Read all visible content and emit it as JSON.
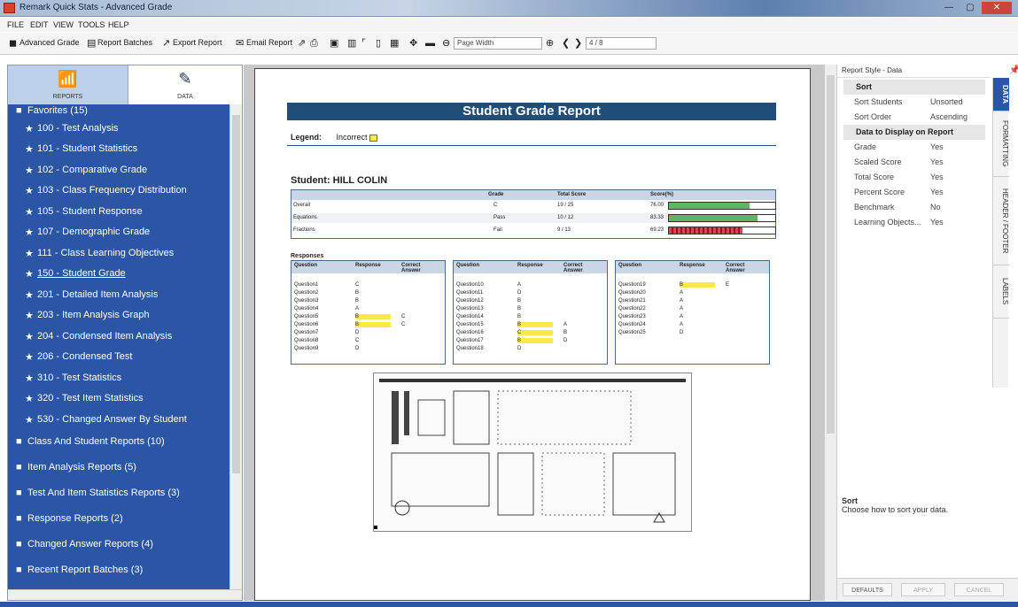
{
  "window": {
    "title": "Remark Quick Stats - Advanced Grade",
    "controls": [
      "—",
      "▢",
      "✕"
    ]
  },
  "menu": [
    "FILE",
    "EDIT",
    "VIEW",
    "TOOLS",
    "HELP"
  ],
  "toolbar": {
    "advanced_grade": "Advanced Grade",
    "report_batches": "Report Batches",
    "export_report": "Export Report",
    "email_report": "Email Report",
    "zoom": "Page Width",
    "page": "4 / 8"
  },
  "sidebar": {
    "tabs": [
      {
        "label": "REPORTS",
        "icon": "bar-chart-icon"
      },
      {
        "label": "DATA",
        "icon": "edit-icon"
      }
    ],
    "items": [
      {
        "label": "Favorites (15)",
        "type": "folder"
      },
      {
        "label": "100 - Test Analysis",
        "type": "star"
      },
      {
        "label": "101 - Student Statistics",
        "type": "star"
      },
      {
        "label": "102 - Comparative Grade",
        "type": "star"
      },
      {
        "label": "103 - Class Frequency Distribution",
        "type": "star"
      },
      {
        "label": "105 - Student Response",
        "type": "star"
      },
      {
        "label": "107 - Demographic Grade",
        "type": "star"
      },
      {
        "label": "111 - Class Learning Objectives",
        "type": "star"
      },
      {
        "label": "150 - Student Grade",
        "type": "star"
      },
      {
        "label": "201 - Detailed Item Analysis",
        "type": "star"
      },
      {
        "label": "203 - Item Analysis Graph",
        "type": "star"
      },
      {
        "label": "204 - Condensed Item Analysis",
        "type": "star"
      },
      {
        "label": "206 - Condensed Test",
        "type": "star"
      },
      {
        "label": "310 - Test Statistics",
        "type": "star"
      },
      {
        "label": "320 - Test Item Statistics",
        "type": "star"
      },
      {
        "label": "530 - Changed Answer By Student",
        "type": "star"
      },
      {
        "label": "Class And Student Reports (10)",
        "type": "folder"
      },
      {
        "label": "Item Analysis Reports (5)",
        "type": "folder"
      },
      {
        "label": "Test And Item Statistics Reports (3)",
        "type": "folder"
      },
      {
        "label": "Response Reports (2)",
        "type": "folder"
      },
      {
        "label": "Changed Answer Reports (4)",
        "type": "folder"
      },
      {
        "label": "Recent Report Batches (3)",
        "type": "folder"
      }
    ]
  },
  "report": {
    "title": "Student Grade Report",
    "legend_label": "Legend:",
    "legend_incorrect": "Incorrect",
    "student": "Student: HILL COLIN",
    "summary_headers": [
      "Grade",
      "Total Score",
      "Score(%)"
    ],
    "summary_rows": [
      {
        "name": "Overall",
        "grade": "C",
        "total": "19 / 25",
        "pct": "76.00",
        "bar": 0.76,
        "color": "#5cb85c"
      },
      {
        "name": "Equations",
        "grade": "Pass",
        "total": "10 / 12",
        "pct": "83.33",
        "bar": 0.83,
        "color": "#5cb85c"
      },
      {
        "name": "Fractions",
        "grade": "Fail",
        "total": "9 / 13",
        "pct": "69.23",
        "bar": 0.69,
        "color": "#e04050"
      }
    ],
    "responses_label": "Responses",
    "resp_headers": [
      "Question",
      "Response",
      "Correct Answer"
    ],
    "responses": [
      [
        [
          "Question1",
          "C",
          ""
        ],
        [
          "Question2",
          "B",
          ""
        ],
        [
          "Question3",
          "B",
          ""
        ],
        [
          "Question4",
          "A",
          ""
        ],
        [
          "Question5",
          "B",
          "C"
        ],
        [
          "Question6",
          "B",
          "C"
        ],
        [
          "Question7",
          "D",
          ""
        ],
        [
          "Question8",
          "C",
          ""
        ],
        [
          "Question9",
          "D",
          ""
        ]
      ],
      [
        [
          "Question10",
          "A",
          ""
        ],
        [
          "Question11",
          "D",
          ""
        ],
        [
          "Question12",
          "B",
          ""
        ],
        [
          "Question13",
          "B",
          ""
        ],
        [
          "Question14",
          "B",
          ""
        ],
        [
          "Question15",
          "B",
          "A"
        ],
        [
          "Question16",
          "C",
          "B"
        ],
        [
          "Question17",
          "B",
          "D"
        ],
        [
          "Question18",
          "D",
          ""
        ]
      ],
      [
        [
          "Question19",
          "B",
          "E"
        ],
        [
          "Question20",
          "A",
          ""
        ],
        [
          "Question21",
          "A",
          ""
        ],
        [
          "Question22",
          "A",
          ""
        ],
        [
          "Question23",
          "A",
          ""
        ],
        [
          "Question24",
          "A",
          ""
        ],
        [
          "Question25",
          "D",
          ""
        ]
      ]
    ]
  },
  "panel": {
    "header": "Report Style - Data",
    "rows": [
      {
        "k": "Sort",
        "v": "",
        "hdr": true
      },
      {
        "k": "Sort Students",
        "v": "Unsorted"
      },
      {
        "k": "Sort Order",
        "v": "Ascending"
      },
      {
        "k": "Data to Display on Report",
        "v": "",
        "hdr": true
      },
      {
        "k": "Grade",
        "v": "Yes"
      },
      {
        "k": "Scaled Score",
        "v": "Yes"
      },
      {
        "k": "Total Score",
        "v": "Yes"
      },
      {
        "k": "Percent Score",
        "v": "Yes"
      },
      {
        "k": "Benchmark",
        "v": "No"
      },
      {
        "k": "Learning Objects...",
        "v": "Yes"
      }
    ],
    "vtabs": [
      "DATA",
      "FORMATTING",
      "HEADER / FOOTER",
      "LABELS"
    ],
    "desc_title": "Sort",
    "desc_text": "Choose how to sort your data.",
    "buttons": [
      "DEFAULTS",
      "APPLY",
      "CANCEL"
    ]
  }
}
